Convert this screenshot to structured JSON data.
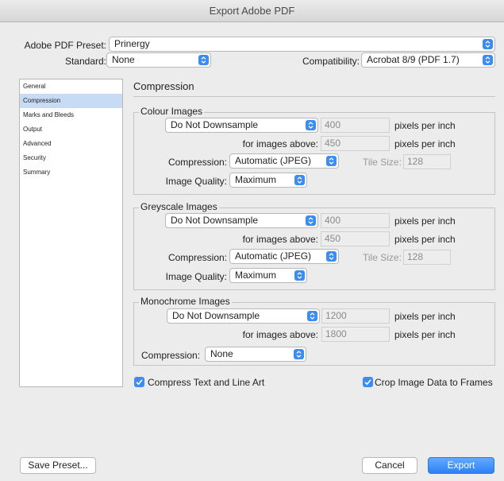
{
  "window": {
    "title": "Export Adobe PDF"
  },
  "preset": {
    "label": "Adobe PDF Preset:",
    "value": "Prinergy"
  },
  "standard": {
    "label": "Standard:",
    "value": "None"
  },
  "compatibility": {
    "label": "Compatibility:",
    "value": "Acrobat 8/9 (PDF 1.7)"
  },
  "sidebar": {
    "items": [
      {
        "label": "General"
      },
      {
        "label": "Compression"
      },
      {
        "label": "Marks and Bleeds"
      },
      {
        "label": "Output"
      },
      {
        "label": "Advanced"
      },
      {
        "label": "Security"
      },
      {
        "label": "Summary"
      }
    ]
  },
  "section_title": "Compression",
  "colour": {
    "title": "Colour Images",
    "downsample": "Do Not Downsample",
    "ppi": "400",
    "ppi_unit": "pixels per inch",
    "above_label": "for images above:",
    "above": "450",
    "above_unit": "pixels per inch",
    "compression_label": "Compression:",
    "compression": "Automatic (JPEG)",
    "tile_label": "Tile Size:",
    "tile": "128",
    "quality_label": "Image Quality:",
    "quality": "Maximum"
  },
  "greyscale": {
    "title": "Greyscale Images",
    "downsample": "Do Not Downsample",
    "ppi": "400",
    "ppi_unit": "pixels per inch",
    "above_label": "for images above:",
    "above": "450",
    "above_unit": "pixels per inch",
    "compression_label": "Compression:",
    "compression": "Automatic (JPEG)",
    "tile_label": "Tile Size:",
    "tile": "128",
    "quality_label": "Image Quality:",
    "quality": "Maximum"
  },
  "mono": {
    "title": "Monochrome Images",
    "downsample": "Do Not Downsample",
    "ppi": "1200",
    "ppi_unit": "pixels per inch",
    "above_label": "for images above:",
    "above": "1800",
    "above_unit": "pixels per inch",
    "compression_label": "Compression:",
    "compression": "None"
  },
  "options": {
    "compress_text": "Compress Text and Line Art",
    "crop_image": "Crop Image Data to Frames"
  },
  "buttons": {
    "save_preset": "Save Preset...",
    "cancel": "Cancel",
    "export": "Export"
  },
  "colors": {
    "accent": "#3b8cf5",
    "selection": "#c7dbf5"
  }
}
